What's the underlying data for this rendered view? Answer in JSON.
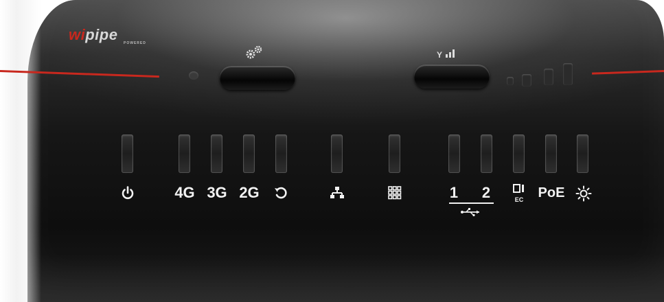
{
  "brand": {
    "logo_prefix": "wi",
    "logo_main": "pipe",
    "logo_sub": "POWERED"
  },
  "top_controls": {
    "left_button_icon": "gear-icon",
    "right_button_icon": "signal-icon",
    "signal_label": "Y"
  },
  "leds": [
    {
      "id": "power",
      "icon": "power-icon"
    },
    {
      "id": "4g",
      "label": "4G"
    },
    {
      "id": "3g",
      "label": "3G"
    },
    {
      "id": "2g",
      "label": "2G"
    },
    {
      "id": "reset",
      "icon": "refresh-icon"
    },
    {
      "id": "network",
      "icon": "network-icon"
    },
    {
      "id": "grid",
      "icon": "grid-icon"
    },
    {
      "id": "usb1",
      "label": "1"
    },
    {
      "id": "usb2",
      "label": "2"
    },
    {
      "id": "sim",
      "icon": "sim-ec-icon",
      "label": "EC"
    },
    {
      "id": "poe",
      "label": "PoE"
    },
    {
      "id": "light",
      "icon": "sun-icon"
    }
  ],
  "usb_group_icon": "usb-icon",
  "colors": {
    "accent_red": "#c8281e",
    "body": "#141414",
    "label": "#f2f2f2"
  }
}
